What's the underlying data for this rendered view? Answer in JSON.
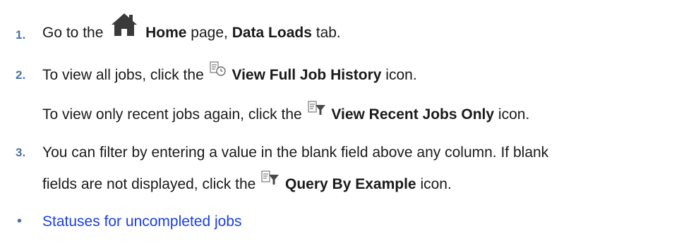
{
  "steps": [
    {
      "number": "1.",
      "pre": "Go to the",
      "icon": "home-icon",
      "bold1": "Home",
      "mid": "page,",
      "bold2": "Data Loads",
      "post": "tab."
    },
    {
      "number": "2.",
      "pre": "To view all jobs, click the",
      "icon": "view-full-job-history-icon",
      "bold": "View Full Job History",
      "post": "icon.",
      "note_pre": "To view only recent jobs again, click the",
      "note_icon": "view-recent-jobs-only-icon",
      "note_bold": "View Recent Jobs Only",
      "note_post": "icon."
    },
    {
      "number": "3.",
      "line1": "You can filter by entering a value in the blank field above any column. If blank",
      "line2_pre": "fields are not displayed, click the",
      "icon": "query-by-example-icon",
      "bold": "Query By Example",
      "post": "icon."
    }
  ],
  "link": {
    "bullet": "•",
    "label": "Statuses for uncompleted jobs"
  },
  "colors": {
    "step_number": "#4a72a8",
    "link": "#1a3fe0",
    "text": "#1a1a1a"
  }
}
